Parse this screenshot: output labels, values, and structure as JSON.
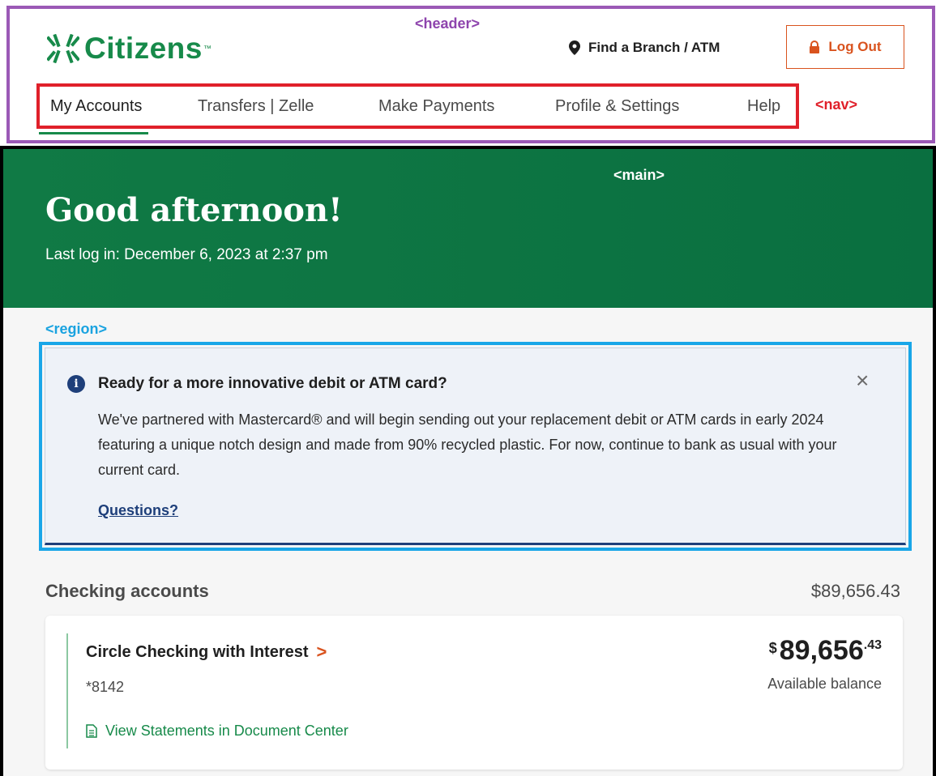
{
  "header": {
    "annotation": "<header>",
    "logo": "Citizens",
    "logo_tm": "™",
    "find_branch": "Find a Branch / ATM",
    "logout": "Log Out"
  },
  "nav": {
    "annotation": "<nav>",
    "items": [
      "My Accounts",
      "Transfers | Zelle",
      "Make Payments",
      "Profile & Settings",
      "Help"
    ],
    "active": "My Accounts"
  },
  "main": {
    "annotation": "<main>",
    "greeting": "Good afternoon!",
    "last_login": "Last log in: December 6, 2023 at 2:37 pm"
  },
  "region": {
    "annotation": "<region>"
  },
  "alert": {
    "info_symbol": "i",
    "title": "Ready for a more innovative debit or ATM card?",
    "body": "We've partnered with Mastercard® and will begin sending out your replacement debit or ATM cards in early 2024 featuring a unique notch design and made from 90% recycled plastic. For now, continue to bank as usual with your current card.",
    "link": "Questions?",
    "close": "×"
  },
  "checking": {
    "title": "Checking accounts",
    "total": "$89,656.43",
    "account": {
      "name": "Circle Checking with Interest",
      "chevron": ">",
      "number": "*8142",
      "statements_link": "View Statements in Document Center",
      "balance_symbol": "$",
      "balance_main": "89,656",
      "balance_cents": ".43",
      "balance_label": "Available balance"
    }
  },
  "colors": {
    "brand_green": "#178a4a",
    "hero_green": "#0a6f40",
    "accent_orange": "#d9531e",
    "alert_navy": "#1e3f7a",
    "header_annotation": "#9b59b6",
    "nav_annotation": "#e0202a",
    "region_annotation": "#19a6e8"
  }
}
